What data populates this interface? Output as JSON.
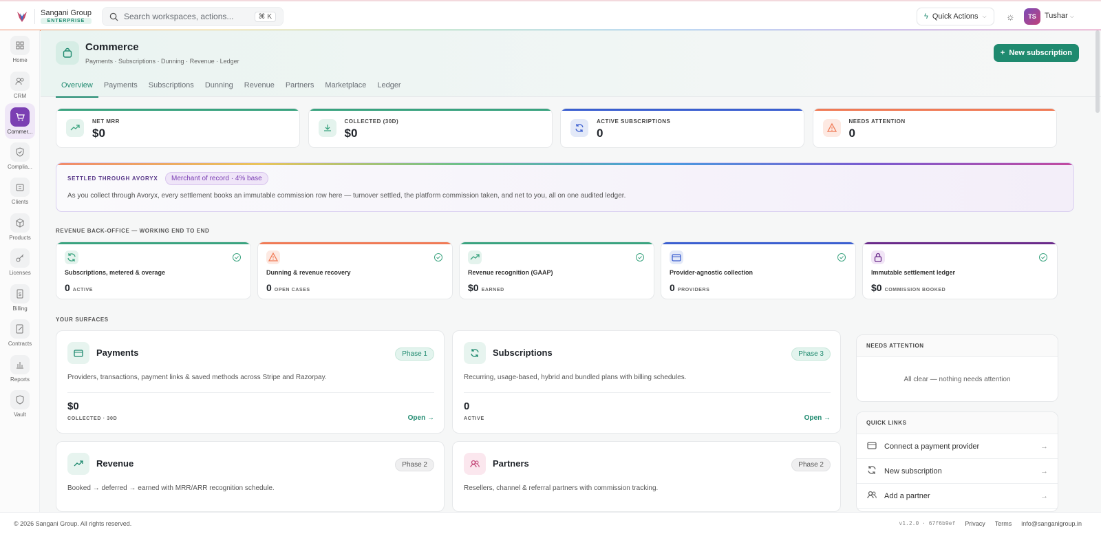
{
  "brand": {
    "name": "Sangani Group",
    "badge": "ENTERPRISE"
  },
  "search": {
    "placeholder": "Search workspaces, actions...",
    "shortcut": "⌘ K"
  },
  "header": {
    "quick_actions": "Quick Actions",
    "user_initials": "TS",
    "user_name": "Tushar"
  },
  "sidebar": {
    "items": [
      {
        "label": "Home",
        "icon": "grid-icon"
      },
      {
        "label": "CRM",
        "icon": "users-icon"
      },
      {
        "label": "Commer...",
        "icon": "cart-icon",
        "active": true
      },
      {
        "label": "Complia...",
        "icon": "shield-icon"
      },
      {
        "label": "Clients",
        "icon": "building-icon"
      },
      {
        "label": "Products",
        "icon": "box-icon"
      },
      {
        "label": "Licenses",
        "icon": "key-icon"
      },
      {
        "label": "Billing",
        "icon": "receipt-icon"
      },
      {
        "label": "Contracts",
        "icon": "contract-icon"
      },
      {
        "label": "Reports",
        "icon": "bar-chart-icon"
      },
      {
        "label": "Vault",
        "icon": "vault-shield-icon"
      }
    ]
  },
  "page": {
    "title": "Commerce",
    "subtitle": "Payments · Subscriptions · Dunning · Revenue · Ledger",
    "new_button": "New subscription",
    "tabs": [
      "Overview",
      "Payments",
      "Subscriptions",
      "Dunning",
      "Revenue",
      "Partners",
      "Marketplace",
      "Ledger"
    ],
    "active_tab": "Overview"
  },
  "kpis": [
    {
      "label": "NET MRR",
      "value": "$0",
      "color": "#3aa37f"
    },
    {
      "label": "COLLECTED (30D)",
      "value": "$0",
      "color": "#3aa37f"
    },
    {
      "label": "ACTIVE SUBSCRIPTIONS",
      "value": "0",
      "color": "#3b5fd0"
    },
    {
      "label": "NEEDS ATTENTION",
      "value": "0",
      "color": "#f07a55"
    }
  ],
  "settlement": {
    "title": "SETTLED THROUGH AVORYX",
    "pill": "Merchant of record · 4% base",
    "description": "As you collect through Avoryx, every settlement books an immutable commission row here — turnover settled, the platform commission taken, and net to you, all on one audited ledger."
  },
  "backoffice": {
    "title": "REVENUE BACK-OFFICE — WORKING END TO END",
    "cards": [
      {
        "title": "Subscriptions, metered & overage",
        "value": "0",
        "unit": "ACTIVE",
        "color": "#3aa37f"
      },
      {
        "title": "Dunning & revenue recovery",
        "value": "0",
        "unit": "OPEN CASES",
        "color": "#f07a55"
      },
      {
        "title": "Revenue recognition (GAAP)",
        "value": "$0",
        "unit": "EARNED",
        "color": "#3aa37f"
      },
      {
        "title": "Provider-agnostic collection",
        "value": "0",
        "unit": "PROVIDERS",
        "color": "#3b5fd0"
      },
      {
        "title": "Immutable settlement ledger",
        "value": "$0",
        "unit": "COMMISSION BOOKED",
        "color": "#6a2a8a"
      }
    ]
  },
  "surfaces": {
    "title": "YOUR SURFACES",
    "cards": [
      {
        "title": "Payments",
        "phase": "Phase 1",
        "desc": "Providers, transactions, payment links & saved methods across Stripe and Razorpay.",
        "value": "$0",
        "label": "COLLECTED · 30D",
        "open": "Open"
      },
      {
        "title": "Subscriptions",
        "phase": "Phase 3",
        "desc": "Recurring, usage-based, hybrid and bundled plans with billing schedules.",
        "value": "0",
        "label": "ACTIVE",
        "open": "Open"
      },
      {
        "title": "Revenue",
        "phase": "Phase 2",
        "desc": "Booked → deferred → earned with MRR/ARR recognition schedule."
      },
      {
        "title": "Partners",
        "phase": "Phase 2",
        "desc": "Resellers, channel & referral partners with commission tracking."
      }
    ]
  },
  "needs_attention": {
    "title": "NEEDS ATTENTION",
    "empty": "All clear — nothing needs attention"
  },
  "quick_links": {
    "title": "QUICK LINKS",
    "items": [
      "Connect a payment provider",
      "New subscription",
      "Add a partner"
    ]
  },
  "footer": {
    "copyright": "© 2026 Sangani Group. All rights reserved.",
    "version": "v1.2.0 · 67f6b9ef",
    "privacy": "Privacy",
    "terms": "Terms",
    "email": "info@sanganigroup.in"
  }
}
